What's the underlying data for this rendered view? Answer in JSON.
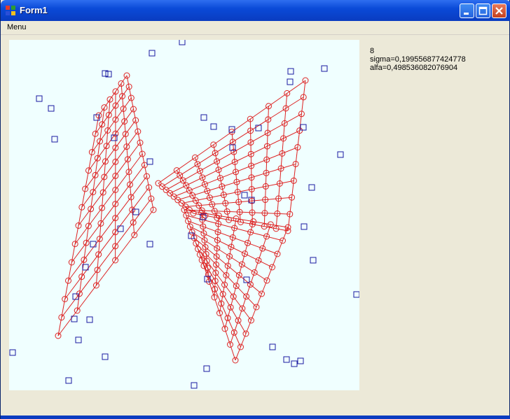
{
  "window": {
    "title": "Form1",
    "icons": {
      "app": "app-icon",
      "minimize": "minimize-icon",
      "maximize": "maximize-icon",
      "close": "close-icon"
    }
  },
  "menu": {
    "items": [
      {
        "label": "Menu"
      }
    ]
  },
  "info": {
    "iteration": "8",
    "sigma": "sigma=0,199556877424778",
    "alfa": "alfa=0,498536082076904"
  },
  "colors": {
    "canvas_bg": "#f0ffff",
    "mesh": "#dd2222",
    "points": "#1a1aa0"
  }
}
